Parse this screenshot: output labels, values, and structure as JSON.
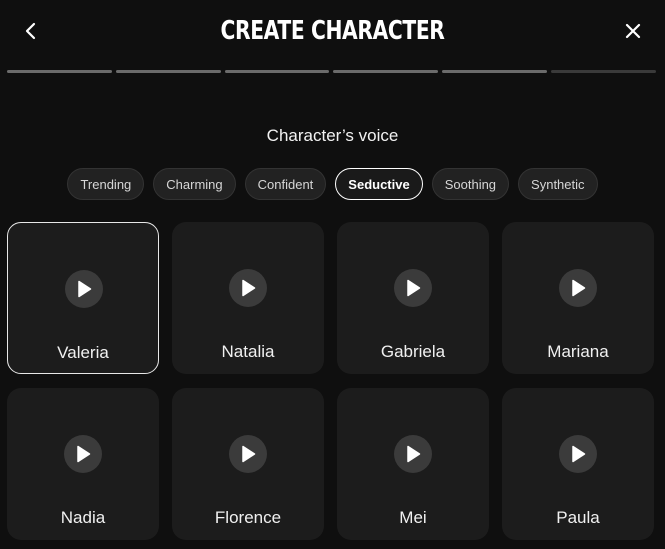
{
  "header": {
    "title": "CREATE CHARACTER",
    "back_icon": "chevron-left-icon",
    "close_icon": "close-icon"
  },
  "progress": {
    "total_steps": 6,
    "completed_steps": 5
  },
  "section": {
    "title": "Character’s voice"
  },
  "voice_categories": {
    "items": [
      "Trending",
      "Charming",
      "Confident",
      "Seductive",
      "Soothing",
      "Synthetic"
    ],
    "selected": "Seductive"
  },
  "voices": {
    "items": [
      {
        "name": "Valeria",
        "selected": true
      },
      {
        "name": "Natalia",
        "selected": false
      },
      {
        "name": "Gabriela",
        "selected": false
      },
      {
        "name": "Mariana",
        "selected": false
      },
      {
        "name": "Nadia",
        "selected": false
      },
      {
        "name": "Florence",
        "selected": false
      },
      {
        "name": "Mei",
        "selected": false
      },
      {
        "name": "Paula",
        "selected": false
      }
    ],
    "play_icon": "play-icon"
  },
  "colors": {
    "background": "#0f0f0f",
    "card": "#1c1c1c",
    "chip": "#222222",
    "progress_done": "#6b6b6b",
    "progress_pending": "#3a3a3a",
    "accent_border": "#ffffff"
  }
}
